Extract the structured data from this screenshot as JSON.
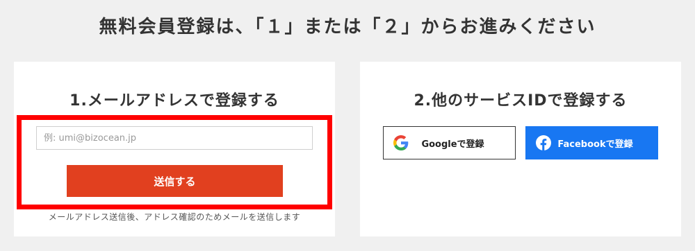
{
  "page": {
    "title": "無料会員登録は、「１」または「２」からお進みください"
  },
  "email_section": {
    "title": "1.メールアドレスで登録する",
    "input_placeholder": "例: umi@bizocean.jp",
    "input_value": "",
    "submit_label": "送信する",
    "note": "メールアドレス送信後、アドレス確認のためメールを送信します",
    "accent_color": "#e1401f",
    "highlight_color": "#ff0000"
  },
  "sso_section": {
    "title": "2.他のサービスIDで登録する",
    "google_label": "Googleで登録",
    "google_icon": "google-g-icon",
    "facebook_label": "Facebookで登録",
    "facebook_icon": "facebook-f-icon",
    "facebook_color": "#1877f2"
  }
}
